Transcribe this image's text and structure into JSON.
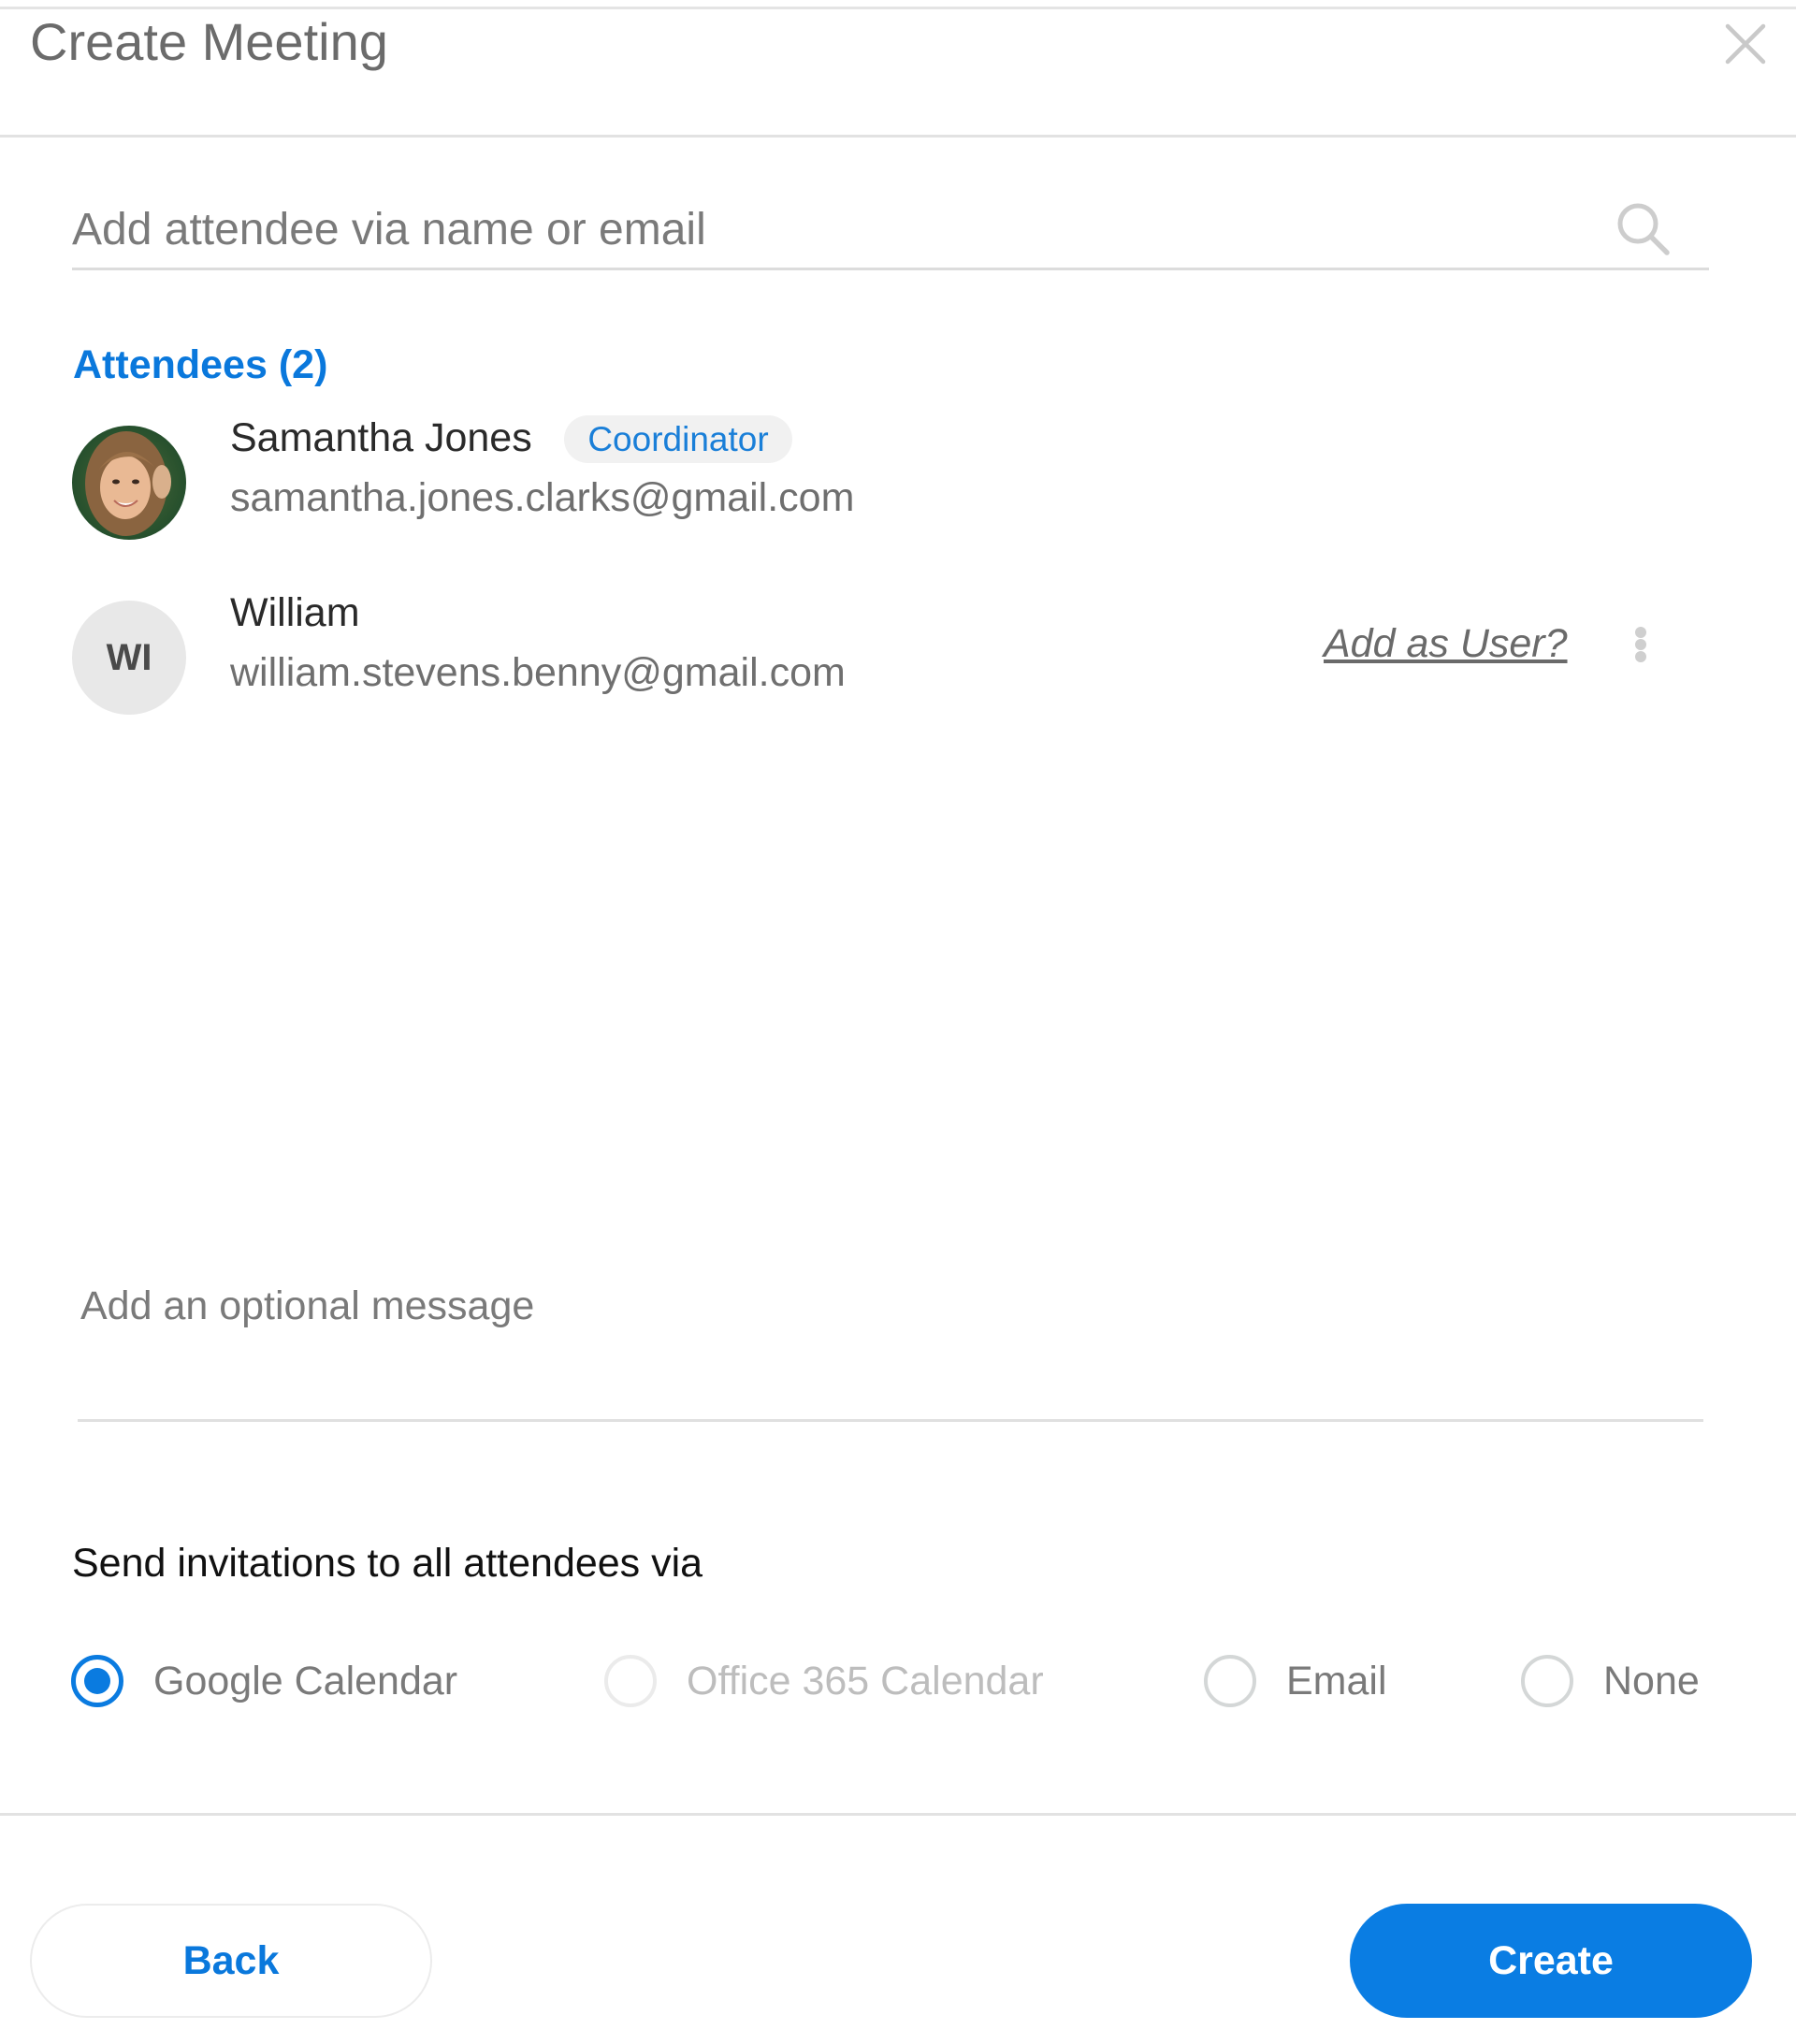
{
  "dialog": {
    "title": "Create Meeting",
    "close_icon": "close-icon"
  },
  "search": {
    "placeholder": "Add attendee via name or email",
    "value": "",
    "icon": "search-icon"
  },
  "attendees": {
    "heading": "Attendees (2)",
    "count": 2,
    "items": [
      {
        "name": "Samantha Jones",
        "email": "samantha.jones.clarks@gmail.com",
        "badge": "Coordinator",
        "avatar": "photo"
      },
      {
        "name": "William",
        "email": "william.stevens.benny@gmail.com",
        "initials": "WI",
        "action_link": "Add as User?",
        "menu_icon": "more-vertical-icon"
      }
    ]
  },
  "message": {
    "placeholder": "Add an optional message",
    "value": ""
  },
  "invitations": {
    "label": "Send invitations to all attendees via",
    "options": [
      {
        "label": "Google Calendar",
        "selected": true,
        "disabled": false
      },
      {
        "label": "Office 365 Calendar",
        "selected": false,
        "disabled": true
      },
      {
        "label": "Email",
        "selected": false,
        "disabled": false
      },
      {
        "label": "None",
        "selected": false,
        "disabled": false
      }
    ]
  },
  "footer": {
    "back_label": "Back",
    "create_label": "Create"
  },
  "colors": {
    "accent": "#0a7de3",
    "link_blue": "#0a78dc",
    "badge_bg": "#f1f1f1",
    "divider": "#e2e2e2"
  }
}
